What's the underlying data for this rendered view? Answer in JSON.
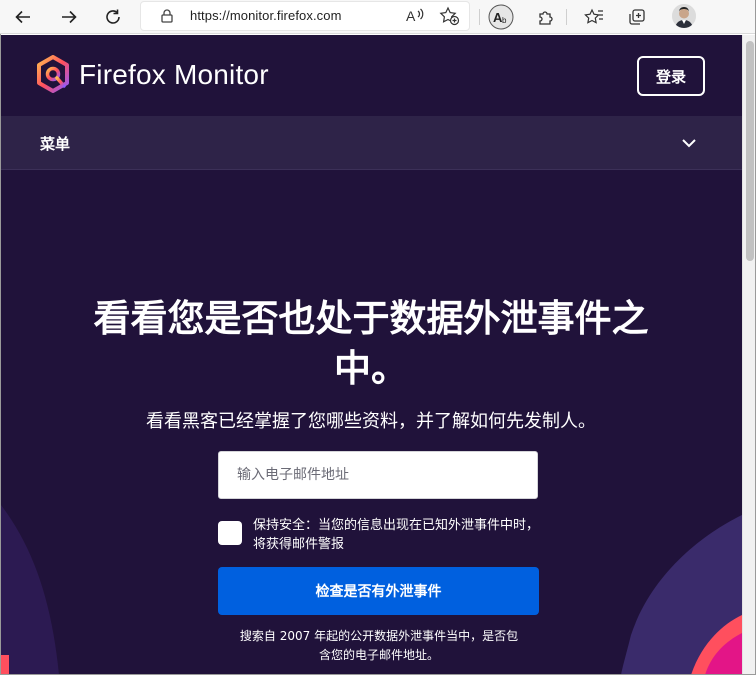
{
  "browser": {
    "url": "https://monitor.firefox.com",
    "icons": [
      "back-icon",
      "forward-icon",
      "refresh-icon",
      "lock-icon",
      "read-aloud-icon",
      "add-favorite-icon",
      "immersive-reader-icon",
      "extensions-icon",
      "favorites-icon",
      "collections-icon",
      "profile-avatar"
    ]
  },
  "site": {
    "brand": "Firefox Monitor",
    "login_label": "登录",
    "menu_label": "菜单"
  },
  "hero": {
    "title": "看看您是否也处于数据外泄事件之中。",
    "subtitle": "看看黑客已经掌握了您哪些资料，并了解如何先发制人。",
    "email_placeholder": "输入电子邮件地址",
    "alert_checkbox_label": "保持安全：当您的信息出现在已知外泄事件中时，将获得邮件警报",
    "check_button_label": "检查是否有外泄事件",
    "footnote": "搜索自 2007 年起的公开数据外泄事件当中，是否包含您的电子邮件地址。"
  },
  "colors": {
    "page_bg": "#20123a",
    "menu_bg": "#2e2348",
    "button_blue": "#0060df",
    "accent_pink": "#ff4f5e",
    "accent_purple": "#592acb"
  }
}
